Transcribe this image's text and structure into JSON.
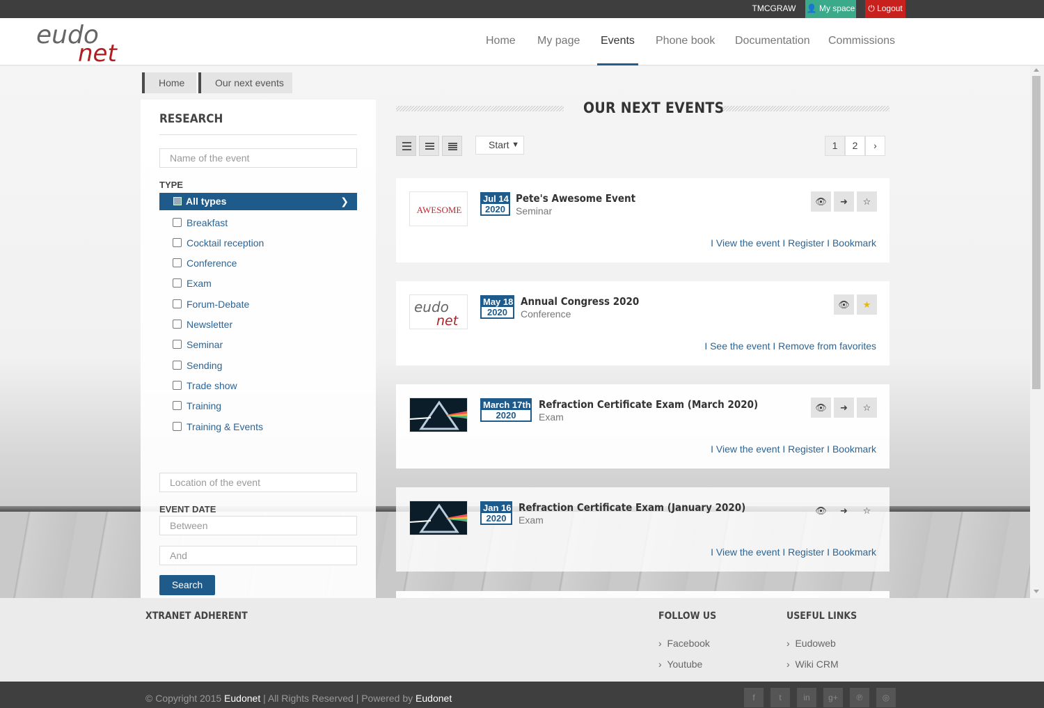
{
  "topbar": {
    "user": "TMCGRAW",
    "myspace": "My space",
    "logout": "Logout"
  },
  "logo": {
    "top": "eudo",
    "bottom": "net"
  },
  "nav": [
    "Home",
    "My page",
    "Events",
    "Phone book",
    "Documentation",
    "Commissions"
  ],
  "nav_active": "Events",
  "breadcrumb": [
    "Home",
    "Our next events"
  ],
  "sidebar": {
    "title": "RESEARCH",
    "name_placeholder": "Name of the event",
    "type_label": "TYPE",
    "all_types": "All types",
    "types": [
      "Breakfast",
      "Cocktail reception",
      "Conference",
      "Exam",
      "Forum-Debate",
      "Newsletter",
      "Seminar",
      "Sending",
      "Trade show",
      "Training",
      "Training & Events"
    ],
    "location_placeholder": "Location of the event",
    "date_label": "EVENT DATE",
    "between_placeholder": "Between",
    "and_placeholder": "And",
    "search": "Search"
  },
  "main": {
    "title": "OUR NEXT EVENTS",
    "sort_value": "Start",
    "pages": [
      "1",
      "2",
      "›"
    ]
  },
  "events": [
    {
      "month_day": "Jul 14",
      "year": "2020",
      "name": "Pete's Awesome Event",
      "type": "Seminar",
      "thumb_text": "AWESOME",
      "link1": "View the event",
      "link2": "Register",
      "link3": "Bookmark",
      "bookmarked": false
    },
    {
      "month_day": "May 18",
      "year": "2020",
      "name": "Annual Congress 2020",
      "type": "Conference",
      "thumb_text": "eudonet",
      "link1": "See the event",
      "link2": "Remove from favorites",
      "link3": "",
      "bookmarked": true
    },
    {
      "month_day": "March 17th",
      "year": "2020",
      "name": "Refraction Certificate Exam (March 2020)",
      "type": "Exam",
      "thumb_text": "",
      "link1": "View the event",
      "link2": "Register",
      "link3": "Bookmark",
      "bookmarked": false
    },
    {
      "month_day": "Jan 16",
      "year": "2020",
      "name": "Refraction Certificate Exam (January 2020)",
      "type": "Exam",
      "thumb_text": "",
      "link1": "View the event",
      "link2": "Register",
      "link3": "Bookmark",
      "bookmarked": false
    }
  ],
  "footer": {
    "xtranet": "XTRANET ADHERENT",
    "follow_title": "FOLLOW US",
    "follow_links": [
      "Facebook",
      "Youtube"
    ],
    "useful_title": "USEFUL LINKS",
    "useful_links": [
      "Eudoweb",
      "Wiki CRM"
    ],
    "copyright_pre": "© Copyright 2015 ",
    "copyright_brand": "Eudonet",
    "copyright_mid": " | All Rights Reserved | Powered by ",
    "copyright_brand2": "Eudonet",
    "social": [
      "facebook-icon",
      "twitter-icon",
      "linkedin-icon",
      "googleplus-icon",
      "pinterest-icon",
      "dribbble-icon"
    ]
  },
  "colors": {
    "primary": "#1e5a8a",
    "link": "#2a6496",
    "myspace": "#3aaa8a",
    "logout": "#c8201d",
    "logo_red": "#b11f24"
  }
}
